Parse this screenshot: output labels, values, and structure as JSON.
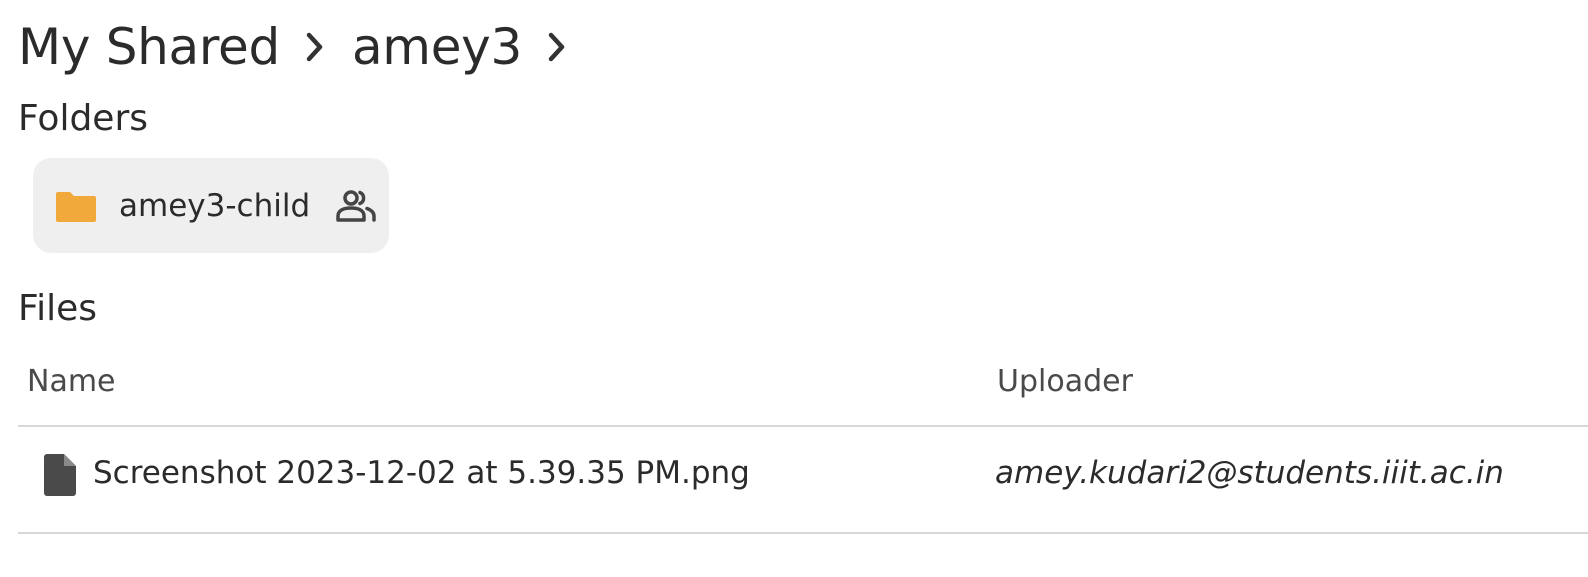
{
  "breadcrumb": {
    "items": [
      {
        "label": "My Shared"
      },
      {
        "label": "amey3"
      }
    ]
  },
  "folders": {
    "title": "Folders",
    "items": [
      {
        "name": "amey3-child",
        "icon": "folder-icon",
        "shared_icon": "people-icon",
        "color": "#f2a93b"
      }
    ]
  },
  "files": {
    "title": "Files",
    "columns": {
      "name": "Name",
      "uploader": "Uploader"
    },
    "rows": [
      {
        "name": "Screenshot 2023-12-02 at 5.39.35 PM.png",
        "uploader": "amey.kudari2@students.iiit.ac.in",
        "icon": "file-icon"
      }
    ]
  }
}
